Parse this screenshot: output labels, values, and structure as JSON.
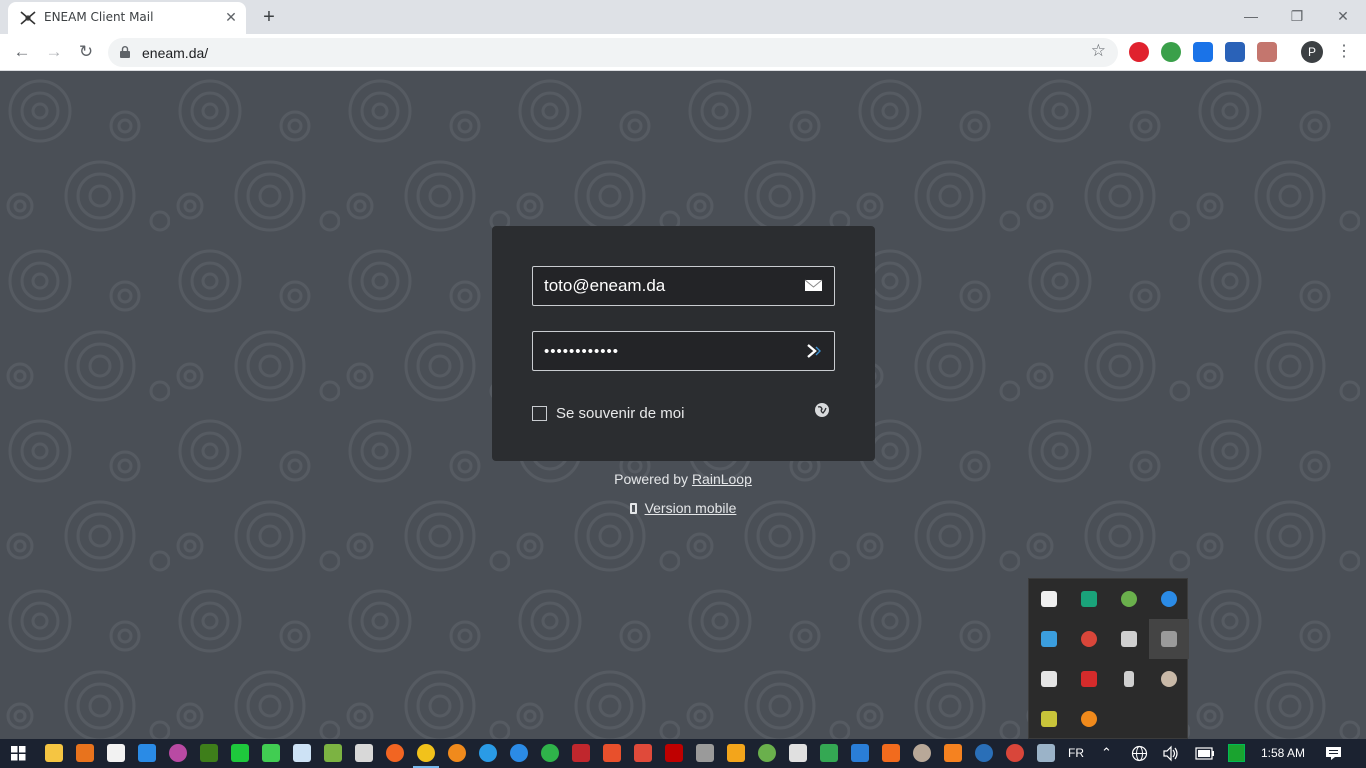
{
  "browser": {
    "tab_title": "ENEAM Client Mail",
    "tab_close": "✕",
    "new_tab": "+",
    "url": "eneam.da/",
    "profile_initial": "P",
    "window_controls": {
      "minimize": "—",
      "restore": "❐",
      "close": "✕"
    },
    "nav": {
      "back": "←",
      "forward": "→",
      "reload": "↻",
      "bookmark": "☆",
      "menu": "⋮"
    },
    "extensions": [
      "opera-icon",
      "globe-extension-icon",
      "download-extension-icon",
      "stats-extension-icon",
      "pdf-extension-icon"
    ]
  },
  "login": {
    "email_value": "toto@eneam.da",
    "password_value": "••••••••••••",
    "remember_label": "Se souvenir de moi",
    "remember_checked": false
  },
  "footer": {
    "powered_prefix": "Powered by ",
    "powered_link": "RainLoop",
    "mobile_link": "Version mobile"
  },
  "taskbar": {
    "language": "FR",
    "time": "1:58 AM",
    "tray_up_arrow": "⌃"
  },
  "colors": {
    "page_background": "#4a4f56",
    "login_panel": "#2b2d30",
    "taskbar": "#1b2230",
    "accent_running": "#76b9ed"
  }
}
